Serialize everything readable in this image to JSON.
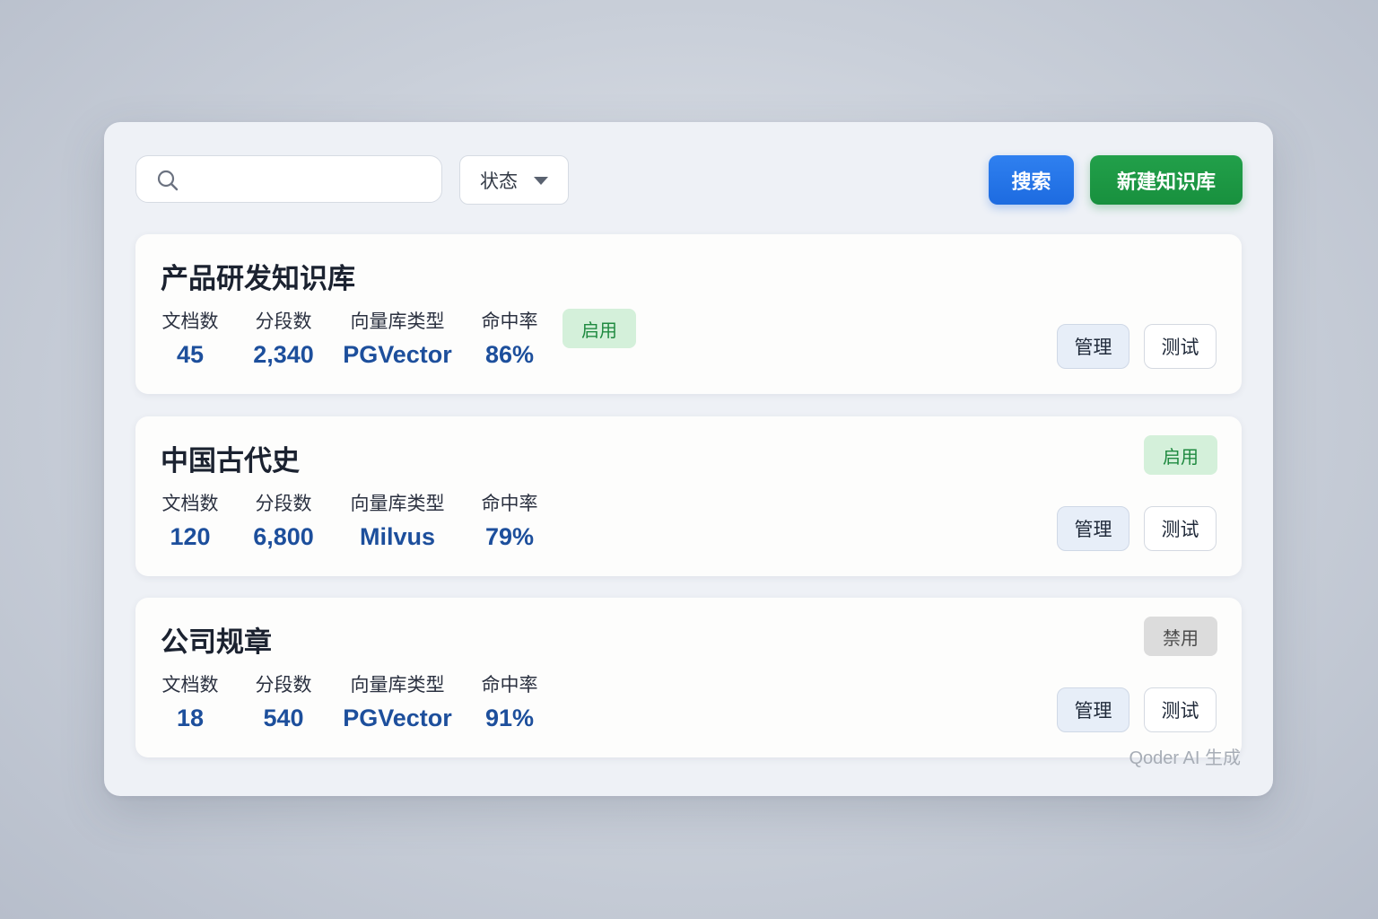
{
  "toolbar": {
    "search_placeholder": "",
    "search_value": "",
    "status_label": "状态",
    "search_button": "搜索",
    "new_button": "新建知识库"
  },
  "stat_labels": {
    "docs": "文档数",
    "segments": "分段数",
    "vector_type": "向量库类型",
    "hit_rate": "命中率"
  },
  "actions": {
    "manage": "管理",
    "test": "测试"
  },
  "cards": [
    {
      "title": "产品研发知识库",
      "docs": "45",
      "segments": "2,340",
      "vector_type": "PGVector",
      "hit_rate": "86%",
      "status": "启用"
    },
    {
      "title": "中国古代史",
      "docs": "120",
      "segments": "6,800",
      "vector_type": "Milvus",
      "hit_rate": "79%",
      "status": "启用"
    },
    {
      "title": "公司规章",
      "docs": "18",
      "segments": "540",
      "vector_type": "PGVector",
      "hit_rate": "91%",
      "status": "禁用"
    }
  ],
  "watermark": "Qoder AI 生成",
  "colors": {
    "primary_blue": "#1d6be0",
    "create_green": "#18903e",
    "value_blue": "#1d4f9c",
    "enabled_badge_bg": "#d4f0da",
    "disabled_badge_bg": "#dcdcdc"
  }
}
